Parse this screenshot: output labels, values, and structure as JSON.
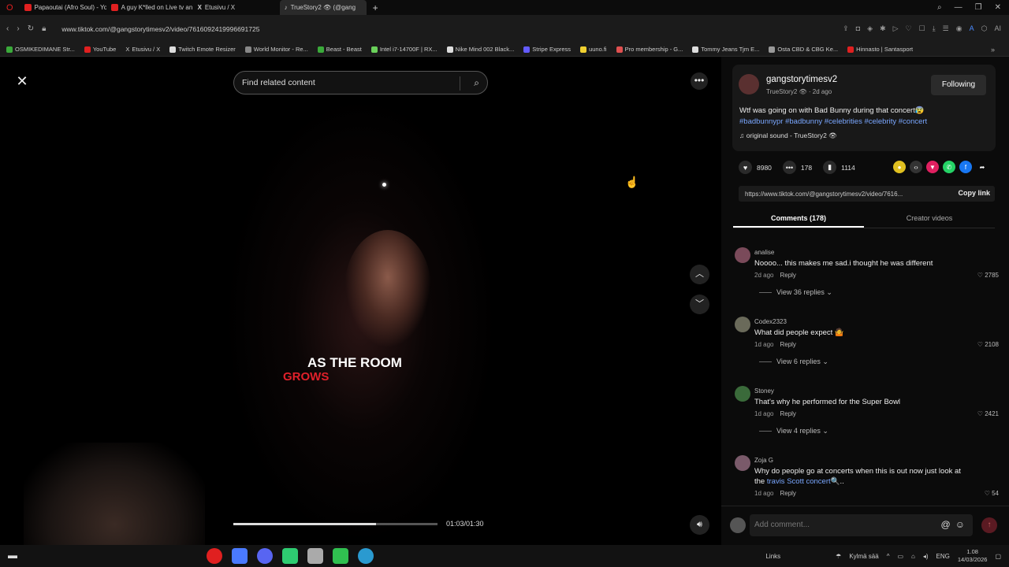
{
  "browser": {
    "tabs": [
      {
        "label": "Papaoutai (Afro Soul) - Yo",
        "color": "#e02020"
      },
      {
        "label": "A guy K*lled on Live tv an",
        "color": "#e02020"
      },
      {
        "label": "Etusivu / X",
        "color": "#ffffff"
      },
      {
        "label": "TrueStory2 👁 (@gang",
        "color": "#ffffff"
      }
    ],
    "url": "www.tiktok.com/@gangstorytimesv2/video/7616092419996691725",
    "bookmarks": [
      {
        "label": "OSMIKEDIMANE Str..."
      },
      {
        "label": "YouTube"
      },
      {
        "label": "Etusivu / X"
      },
      {
        "label": "Twitch Emote Resizer"
      },
      {
        "label": "World Monitor - Re..."
      },
      {
        "label": "Beast - Beast"
      },
      {
        "label": "Intel i7-14700F | RX..."
      },
      {
        "label": "Nike Mind 002 Black..."
      },
      {
        "label": "Stripe Express"
      },
      {
        "label": "uuno.fi"
      },
      {
        "label": "Pro membership - G..."
      },
      {
        "label": "Tommy Jeans Tjm E..."
      },
      {
        "label": "Osta CBD & CBG Ke..."
      },
      {
        "label": "Hinnasto | Santasport"
      }
    ]
  },
  "player": {
    "search_placeholder": "Find related content",
    "caption_line1": "AS THE ROOM",
    "caption_line2": "GROWS",
    "time": "01:03/01:30",
    "progress": 0.7
  },
  "post": {
    "username": "gangstorytimesv2",
    "subline": "TrueStory2 👁 · 2d ago",
    "follow_label": "Following",
    "description": "Wtf was going on with Bad Bunny during that concert😰",
    "tags": "#badbunnypr #badbunny #celebrities #celebrity #concert",
    "sound": "original sound - TrueStory2 👁",
    "likes": "8980",
    "comments_count": "178",
    "saves": "1114",
    "link": "https://www.tiktok.com/@gangstorytimesv2/video/7616...",
    "copy_label": "Copy link",
    "tab_comments": "Comments (178)",
    "tab_creator": "Creator videos"
  },
  "comments": [
    {
      "name": "analise",
      "text": "Noooo... this makes me sad.i thought he was different",
      "meta": "2d ago",
      "reply": "Reply",
      "likes": "2785",
      "replies": "View 36 replies ⌄",
      "avatar": "#7a4a5a"
    },
    {
      "name": "Codex2323",
      "text": "What did people expect 🤷",
      "meta": "1d ago",
      "reply": "Reply",
      "likes": "2108",
      "replies": "View 6 replies ⌄",
      "avatar": "#6a6a5a"
    },
    {
      "name": "Stoney",
      "text": "That's why he performed for the Super Bowl",
      "meta": "1d ago",
      "reply": "Reply",
      "likes": "2421",
      "replies": "View 4 replies ⌄",
      "avatar": "#3a6a3a"
    },
    {
      "name": "Zoja G",
      "text_before": "Why do people go at concerts when this is out now just look at the ",
      "link": "travis Scott concert",
      "text_after": "🔍..",
      "meta": "1d ago",
      "reply": "Reply",
      "likes": "54",
      "avatar": "#7a5a6a"
    }
  ],
  "composer": {
    "placeholder": "Add comment..."
  },
  "taskbar": {
    "links": "Links",
    "weather": "Kylmä sää",
    "lang": "ENG",
    "time": "1.08",
    "date": "14/03/2026"
  }
}
